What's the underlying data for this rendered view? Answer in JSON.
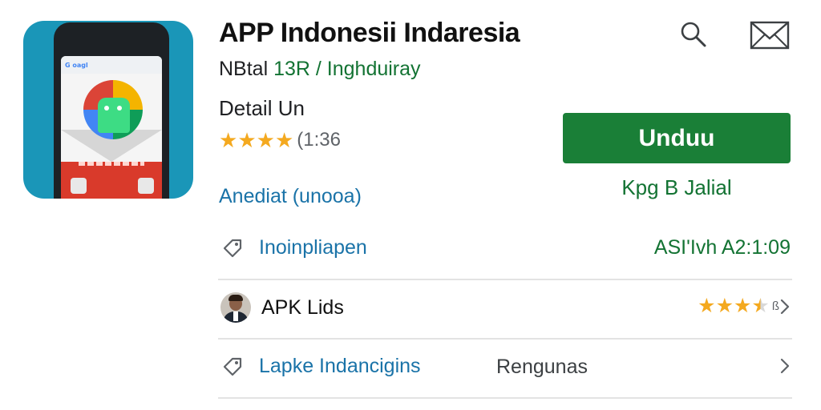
{
  "app": {
    "title": "APP Indonesii Indaresia",
    "developer_plain": "NBtal",
    "developer_link": "13R / Inghduiray",
    "detail": "Detail Un",
    "rating_count": "(1:36",
    "install_link": "Anediat (unooa)",
    "icon_screen_text": "G oagl",
    "stars_filled": 4
  },
  "toolbar": {
    "search_icon": "search-icon",
    "mail_icon": "mail-icon"
  },
  "install": {
    "button_label": "Unduu",
    "sub_label": "Kpg B Jalial",
    "button_color": "#1a7f37"
  },
  "rows": [
    {
      "label": "Inoinpliapen",
      "value": "ASI'Ivh A2:1:09",
      "icon": "tag-icon"
    },
    {
      "label": "APK Lids",
      "stars": 3.5,
      "extra": "ß",
      "icon": "avatar"
    },
    {
      "label": "Lapke Indancigins",
      "value": "Rengunas",
      "icon": "tag-icon"
    }
  ],
  "colors": {
    "accent_green": "#137333",
    "link_blue": "#1a73a8",
    "star": "#f4a91f"
  }
}
